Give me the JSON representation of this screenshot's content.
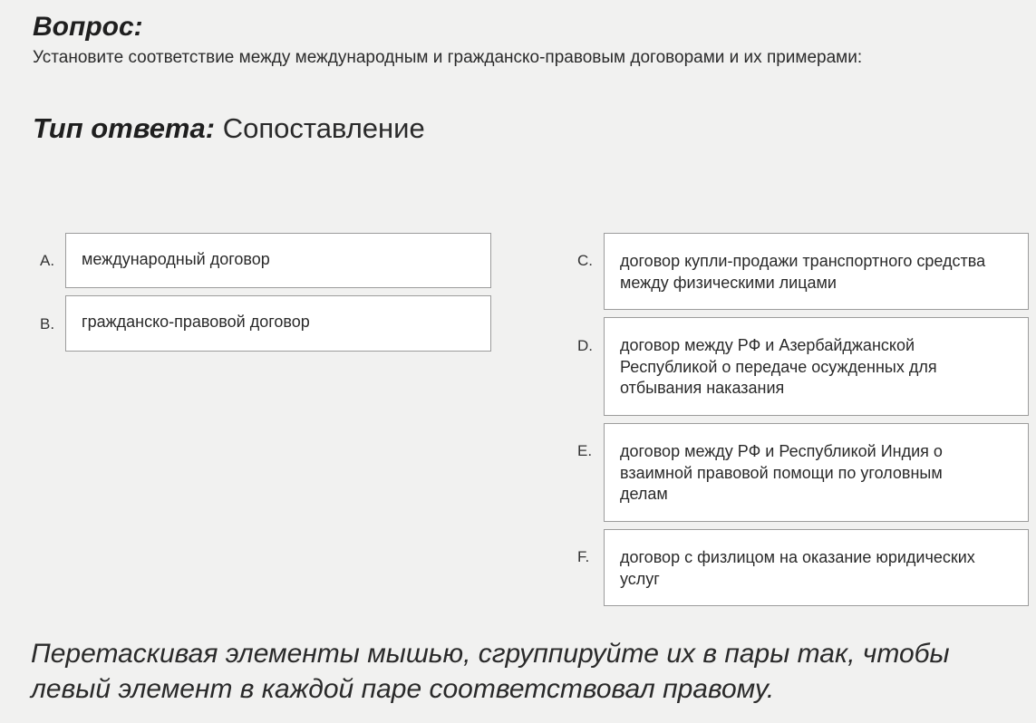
{
  "question": {
    "heading": "Вопрос:",
    "text": "Установите соответствие между международным и гражданско-правовым договорами и их примерами:"
  },
  "answer_type": {
    "label": "Тип ответа:",
    "value": "Сопоставление"
  },
  "left_items": [
    {
      "letter": "A.",
      "text": "международный договор"
    },
    {
      "letter": "B.",
      "text": "гражданско-правовой договор"
    }
  ],
  "right_items": [
    {
      "letter": "C.",
      "text": "договор купли-продажи транспортного средства между физическими лицами"
    },
    {
      "letter": "D.",
      "text": "договор между РФ и Азербайджанской Республикой о передаче осужденных для отбывания наказания"
    },
    {
      "letter": "E.",
      "text": "договор между РФ и Республикой Индия о взаимной правовой помощи по уголовным делам"
    },
    {
      "letter": "F.",
      "text": "договор с физлицом на оказание юридических услуг"
    }
  ],
  "instruction": "Перетаскивая элементы мышью, сгруппируйте их в пары так, чтобы левый элемент в каждой паре соответствовал правому."
}
